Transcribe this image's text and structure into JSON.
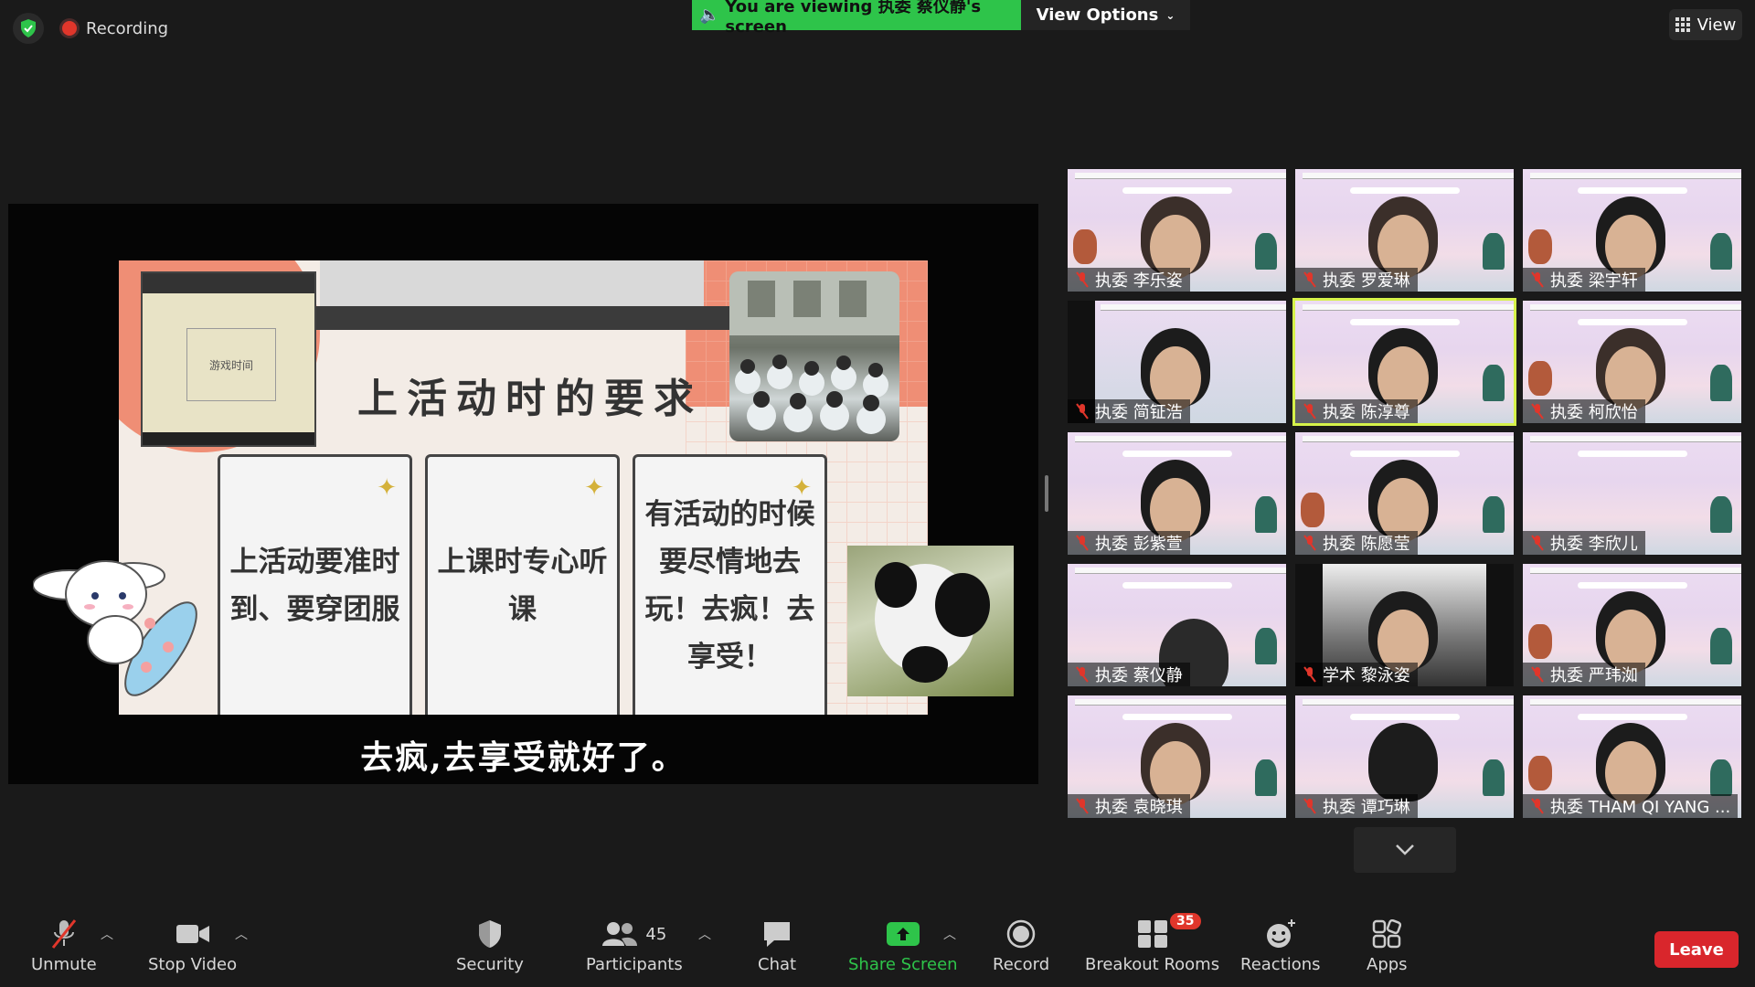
{
  "top": {
    "recording_label": "Recording",
    "banner_text": "You are viewing 执委 蔡仪静's screen",
    "view_options_label": "View Options",
    "view_label": "View"
  },
  "slide": {
    "mini_label": "游戏时间",
    "title": "上活动时的要求",
    "cards": [
      "上活动要准时到、要穿团服",
      "上课时专心听课",
      "有活动的时候要尽情地去玩！去疯！去享受！"
    ],
    "subtitle": "去疯,去享受就好了。"
  },
  "gallery": {
    "participants": [
      {
        "name": "执委 李乐姿"
      },
      {
        "name": "执委 罗爱琳"
      },
      {
        "name": "执委 梁宇轩"
      },
      {
        "name": "执委 简钲浩"
      },
      {
        "name": "执委 陈淳尊"
      },
      {
        "name": "执委 柯欣怡"
      },
      {
        "name": "执委 彭紫萱"
      },
      {
        "name": "执委 陈愿莹"
      },
      {
        "name": "执委 李欣儿"
      },
      {
        "name": "执委 蔡仪静"
      },
      {
        "name": "学术 黎泳姿"
      },
      {
        "name": "执委 严玮洳"
      },
      {
        "name": "执委 袁晓琪"
      },
      {
        "name": "执委  谭巧琳"
      },
      {
        "name": "执委 THAM QI YANG ..."
      }
    ]
  },
  "toolbar": {
    "unmute_label": "Unmute",
    "stop_video_label": "Stop Video",
    "security_label": "Security",
    "participants_label": "Participants",
    "participants_count": "45",
    "chat_label": "Chat",
    "share_screen_label": "Share Screen",
    "record_label": "Record",
    "breakout_label": "Breakout Rooms",
    "breakout_badge": "35",
    "reactions_label": "Reactions",
    "apps_label": "Apps",
    "leave_label": "Leave"
  },
  "colors": {
    "share_green": "#2ec44a",
    "leave_red": "#d9262c",
    "active_speaker": "#d6f24a"
  }
}
